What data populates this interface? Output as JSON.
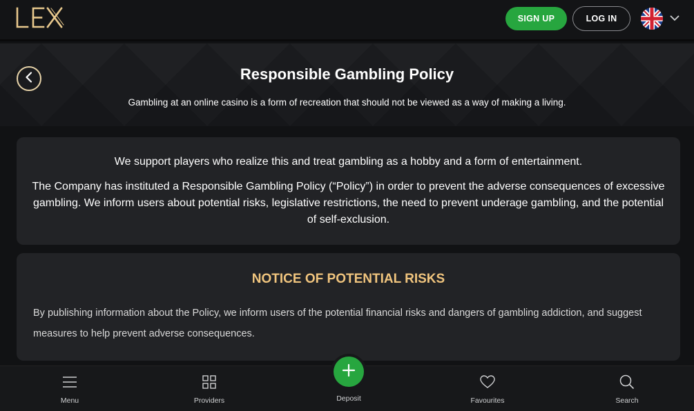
{
  "header": {
    "logo_text": "LEX",
    "signup_label": "SIGN UP",
    "login_label": "LOG IN",
    "language_flag": "uk-flag-icon"
  },
  "hero": {
    "title": "Responsible Gambling Policy",
    "subtitle": "Gambling at an online casino is a form of recreation that should not be viewed as a way of making a living."
  },
  "intro_card": {
    "paragraph1": "We support players who realize this and treat gambling as a hobby and a form of entertainment.",
    "paragraph2": "The Company has instituted a Responsible Gambling Policy (“Policy”) in order to prevent the adverse consequences of excessive gambling. We inform users about potential risks, legislative restrictions, the need to prevent underage gambling, and the potential of self-exclusion."
  },
  "notice_card": {
    "title": "NOTICE OF POTENTIAL RISKS",
    "text": "By publishing information about the Policy, we inform users of the potential financial risks and dangers of gambling addiction, and suggest measures to help prevent adverse consequences."
  },
  "bottom_nav": {
    "items": [
      {
        "label": "Menu",
        "icon": "menu-icon"
      },
      {
        "label": "Providers",
        "icon": "grid-icon"
      },
      {
        "label": "Deposit",
        "icon": "plus-icon"
      },
      {
        "label": "Favourites",
        "icon": "heart-icon"
      },
      {
        "label": "Search",
        "icon": "search-icon"
      }
    ]
  },
  "colors": {
    "accent_green": "#27a63f",
    "gold": "#e9c98d",
    "notice_title": "#f1c57e",
    "card_bg": "#222326",
    "page_bg": "#111214"
  }
}
